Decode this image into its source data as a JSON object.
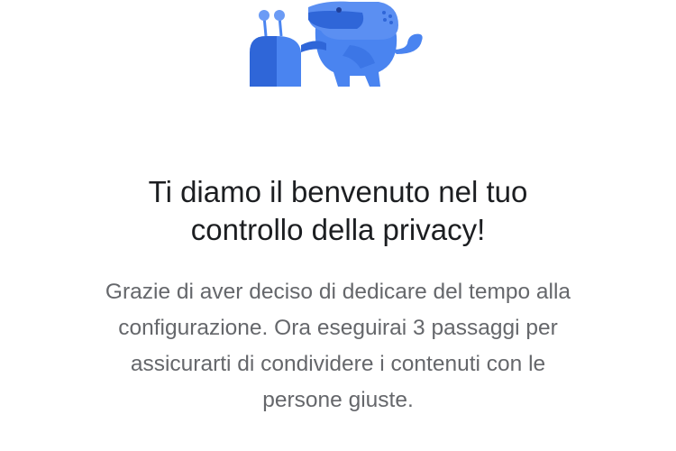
{
  "welcome": {
    "illustration_icon": "privacy-mascot-illustration",
    "title_lines": [
      "Ti diamo il benvenuto nel tuo",
      "controllo della privacy!"
    ],
    "body_lines": [
      "Grazie di aver deciso di dedicare del tempo alla",
      "configurazione. Ora eseguirai 3 passaggi per",
      "assicurarti di condividere i contenuti con le",
      "persone giuste."
    ]
  },
  "colors": {
    "brand_blue": "#4a84f0",
    "brand_blue_dark": "#2f66d8",
    "title_text": "#1c1e21",
    "body_text": "#65676b"
  }
}
